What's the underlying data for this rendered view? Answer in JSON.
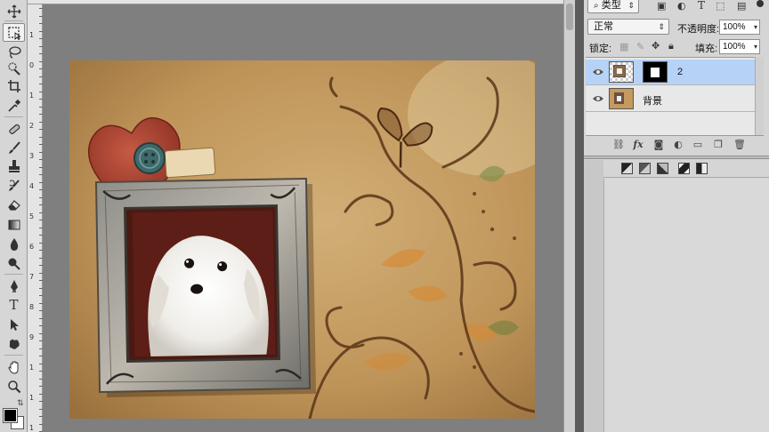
{
  "toolbar": {
    "tools": [
      "move-tool",
      "marquee-tool",
      "lasso-tool",
      "quick-select-tool",
      "crop-tool",
      "eyedropper-tool",
      "healing-brush-tool",
      "brush-tool",
      "clone-stamp-tool",
      "history-brush-tool",
      "eraser-tool",
      "gradient-tool",
      "blur-tool",
      "dodge-tool",
      "pen-tool",
      "type-tool",
      "path-select-tool",
      "shape-tool",
      "hand-tool",
      "zoom-tool"
    ],
    "active_tool": "marquee-tool",
    "type_glyph": "T",
    "foreground_color": "#000000",
    "background_color": "#ffffff"
  },
  "ruler": {
    "left_numbers": [
      "1",
      "0",
      "1",
      "2",
      "3",
      "4",
      "5",
      "6",
      "7",
      "8",
      "9",
      "1",
      "1",
      "1"
    ]
  },
  "layers_panel": {
    "filter_kind": "类型",
    "blend_mode": "正常",
    "opacity_label": "不透明度:",
    "opacity_value": "100%",
    "lock_label": "锁定:",
    "fill_label": "填充:",
    "fill_value": "100%",
    "filter_icons": [
      "image-filter-icon",
      "adjustment-filter-icon",
      "type-filter-icon",
      "shape-filter-icon",
      "smart-object-filter-icon"
    ],
    "layers": [
      {
        "name": "2",
        "selected": true,
        "has_mask": true
      },
      {
        "name": "背景",
        "selected": false,
        "has_mask": false
      }
    ],
    "footer_icons": [
      "link-icon",
      "fx-icon",
      "add-mask-icon",
      "adjustment-layer-icon",
      "group-icon",
      "new-layer-icon",
      "trash-icon"
    ],
    "fx_label": "fx"
  },
  "adjustments_panel": {
    "icons": [
      "levels-icon",
      "curves-icon",
      "exposure-icon",
      "gradient-map-icon",
      "threshold-icon"
    ]
  },
  "colors": {
    "selected_layer": "#b7d2f7",
    "canvas_background": "#c9a46a",
    "workspace": "#7f7f7f"
  }
}
